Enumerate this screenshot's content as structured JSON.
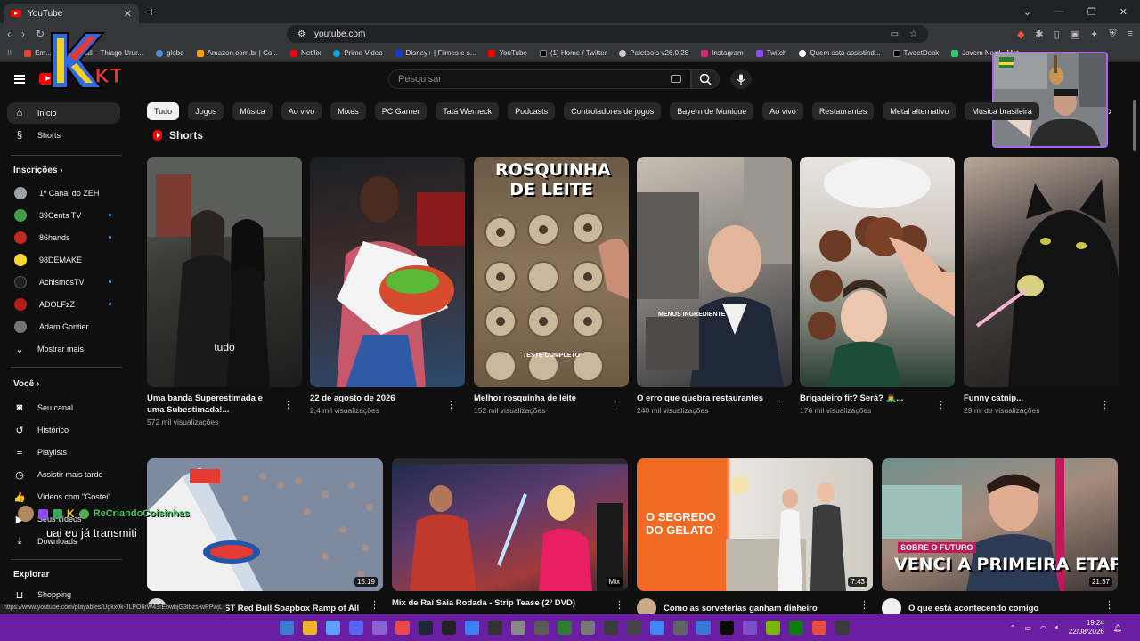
{
  "browser": {
    "tab_title": "YouTube",
    "url": "youtube.com",
    "bookmarks": [
      "Em...",
      "Email – Thiago Urur...",
      "globo",
      "Amazon.com.br | Co...",
      "Netflix",
      "Prime Video",
      "Disney+ | Filmes e s...",
      "YouTube",
      "(1) Home / Twitter",
      "Paletools v26.0.28",
      "Instagram",
      "Twitch",
      "Quem está assistind...",
      "TweetDeck",
      "Jovem Nerd - Mat..."
    ],
    "status_url": "https://www.youtube.com/playables/Ugkx0k-JLPO6rW43rEbwhjG3tbzs-wPPwjL"
  },
  "header": {
    "search_placeholder": "Pesquisar",
    "overlay_logo": "KTV"
  },
  "sidebar": {
    "home": "Início",
    "shorts": "Shorts",
    "subscriptions_heading": "Inscrições",
    "subscriptions": [
      {
        "label": "1º Canal do ZEH",
        "color": "#9aa0a6",
        "live": false
      },
      {
        "label": "39Cents TV",
        "color": "#43a047",
        "live": true
      },
      {
        "label": "86hands",
        "color": "#c62828",
        "live": true
      },
      {
        "label": "98DEMAKE",
        "color": "#fdd835",
        "live": false
      },
      {
        "label": "AchismosTV",
        "color": "#212121",
        "live": true
      },
      {
        "label": "ADOLFzZ",
        "color": "#b71c1c",
        "live": true
      },
      {
        "label": "Adam Gontier",
        "color": "#757575",
        "live": false
      }
    ],
    "show_more": "Mostrar mais",
    "you_heading": "Você",
    "you_items": [
      "Seu canal",
      "Histórico",
      "Playlists",
      "Assistir mais tarde",
      "Vídeos com \"Gostei\"",
      "Seus vídeos",
      "Downloads"
    ],
    "explore_heading": "Explorar",
    "explore_items": [
      "Shopping"
    ]
  },
  "chips": [
    "Tudo",
    "Jogos",
    "Música",
    "Ao vivo",
    "Mixes",
    "PC Gamer",
    "Tatá Werneck",
    "Podcasts",
    "Controladores de jogos",
    "Bayern de Munique",
    "Ao vivo",
    "Restaurantes",
    "Metal alternativo",
    "Música brasileira"
  ],
  "shorts_heading": "Shorts",
  "shorts": [
    {
      "title": "Uma banda Superestimada e uma Subestimada!...",
      "views": "572 mil visualizações",
      "caption": "tudo",
      "bg": "linear-gradient(160deg,#6b6f6a 0%,#3a3a36 40%,#1c1c1c 100%)"
    },
    {
      "title": "22 de agosto de 2026",
      "views": "2,4 mil visualizações",
      "caption": "",
      "bg": "linear-gradient(170deg,#1a1f24 0%,#3b2a2a 40%,#2c4a6d 100%)"
    },
    {
      "title": "Melhor rosquinha de leite",
      "views": "152 mil visualizações",
      "caption": "ROSQUINHA DE LEITE",
      "sub": "TESTE COMPLETO",
      "bg": "linear-gradient(180deg,#6c5a47 0%,#8a7459 50%,#6e5a45 100%)"
    },
    {
      "title": "O erro que quebra restaurantes",
      "views": "240 mil visualizações",
      "caption": "",
      "sub": "MENOS INGREDIENTE +",
      "bg": "linear-gradient(160deg,#c8c0b5 0%,#8b8580 45%,#2f3035 100%)"
    },
    {
      "title": "Brigadeiro fit? Será? 🙇‍♂️...",
      "views": "176 mil visualizações",
      "caption": "",
      "bg": "linear-gradient(180deg,#e8e4df 0%,#b28a76 35%,#5e3b2c 65%,#1f3b2e 100%)"
    },
    {
      "title": "Funny catnip...",
      "views": "29 mi de visualizações",
      "caption": "",
      "bg": "linear-gradient(160deg,#b9a79a 0%,#4d4643 40%,#1b1b1b 100%)"
    }
  ],
  "videos": [
    {
      "title": "The STEEPEST Red Bull Soapbox Ramp of All",
      "duration": "15:19",
      "bg": "linear-gradient(180deg,#9fc4e6 0%,#cfd8e0 30%,#6e8096 60%,#d8d8d8 100%)"
    },
    {
      "title": "Mix de Raí Saia Rodada - Strip Tease (2º DVD)",
      "duration": "Mix",
      "bg": "linear-gradient(160deg,#1d2a4a 0%,#5a3b6e 40%,#a23a3a 75%,#2b2b2b 100%)"
    },
    {
      "title": "Como as sorveterias ganham dinheiro",
      "duration": "7:43",
      "overlay": "O SEGREDO DO GELATO",
      "bg": "linear-gradient(90deg,#f06a23 0%,#f06a23 38%,#e9e6e0 40%,#cfcac2 100%)"
    },
    {
      "title": "O que está acontecendo comigo",
      "duration": "21:37",
      "overlay": "VENCI A PRIMEIRA ETAPA",
      "tag": "SOBRE O FUTURO",
      "bg": "linear-gradient(160deg,#6f8f8e 0%,#a58b7c 45%,#3d3535 100%)"
    }
  ],
  "chat": {
    "user": "ReCriandoCoisinhas",
    "message": "uai eu já transmiti"
  },
  "taskbar": {
    "time": "19:24",
    "date": "22/08/2026",
    "icon_colors": [
      "#3a7bd5",
      "#f0b429",
      "#5aa0ff",
      "#5865f2",
      "#8a63d2",
      "#e6484d",
      "#1b2838",
      "#222",
      "#3b82f6",
      "#333",
      "#888",
      "#5a5a5a",
      "#2e7d32",
      "#777",
      "#3b3b3b",
      "#444",
      "#4285f4",
      "#5f6368",
      "#3a78d8",
      "#0a0a0a",
      "#7a4fc9",
      "#76b900",
      "#107c10",
      "#e74c3c",
      "#3b3b3b"
    ]
  }
}
